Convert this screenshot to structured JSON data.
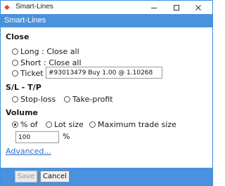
{
  "window": {
    "title": "Smart-Lines",
    "icons": {
      "app": "diamond-icon",
      "minimize": "minimize-icon",
      "maximize": "maximize-icon",
      "close": "close-icon"
    },
    "accent": "#4a92dd",
    "border_color": "#3c8fe0"
  },
  "header": {
    "title": "Smart-Lines"
  },
  "close_section": {
    "title": "Close",
    "options": [
      {
        "label": "Long : Close all",
        "checked": false
      },
      {
        "label": "Short : Close all",
        "checked": false
      },
      {
        "label": "Ticket :",
        "checked": false
      }
    ],
    "ticket_value": "#93013479 Buy 1.00 @ 1.10268"
  },
  "sltp_section": {
    "title": "S/L - T/P",
    "options": [
      {
        "label": "Stop-loss",
        "checked": false
      },
      {
        "label": "Take-profit",
        "checked": false
      }
    ]
  },
  "volume_section": {
    "title": "Volume",
    "options": [
      {
        "label": "% of",
        "checked": true
      },
      {
        "label": "Lot size",
        "checked": false
      },
      {
        "label": "Maximum trade size",
        "checked": false
      }
    ],
    "amount_value": "100",
    "unit": "%"
  },
  "advanced_link": "Advanced...",
  "footer": {
    "save_label": "Save",
    "save_enabled": false,
    "cancel_label": "Cancel"
  }
}
